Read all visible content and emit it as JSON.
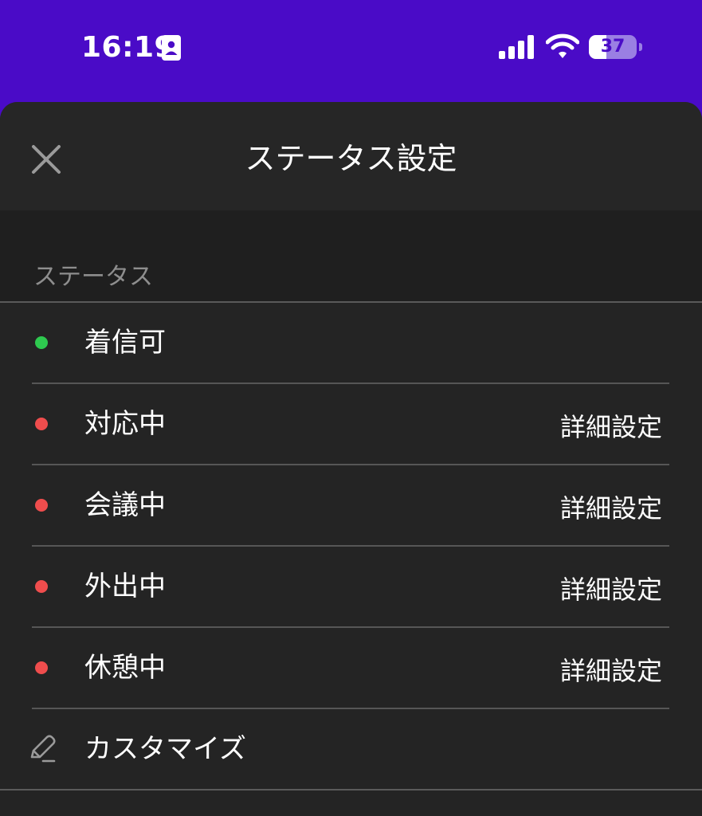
{
  "status_bar": {
    "time": "16:19",
    "battery_level": "37",
    "battery_fraction": 0.37,
    "icons": [
      "contact-card-icon",
      "cellular-signal-icon",
      "wifi-icon",
      "battery-icon"
    ]
  },
  "sheet": {
    "title": "ステータス設定",
    "close_icon": "close-icon",
    "section_label": "ステータス",
    "statuses": [
      {
        "name": "着信可",
        "color": "#2ec94f",
        "detail": ""
      },
      {
        "name": "対応中",
        "color": "#ef4d4d",
        "detail": "詳細設定"
      },
      {
        "name": "会議中",
        "color": "#ef4d4d",
        "detail": "詳細設定"
      },
      {
        "name": "外出中",
        "color": "#ef4d4d",
        "detail": "詳細設定"
      },
      {
        "name": "休憩中",
        "color": "#ef4d4d",
        "detail": "詳細設定"
      }
    ],
    "customize_label": "カスタマイズ",
    "customize_icon": "pencil-icon"
  },
  "colors": {
    "accent": "#4a0bc7",
    "sheet_background": "#242424",
    "available": "#2ec94f",
    "busy": "#ef4d4d"
  }
}
